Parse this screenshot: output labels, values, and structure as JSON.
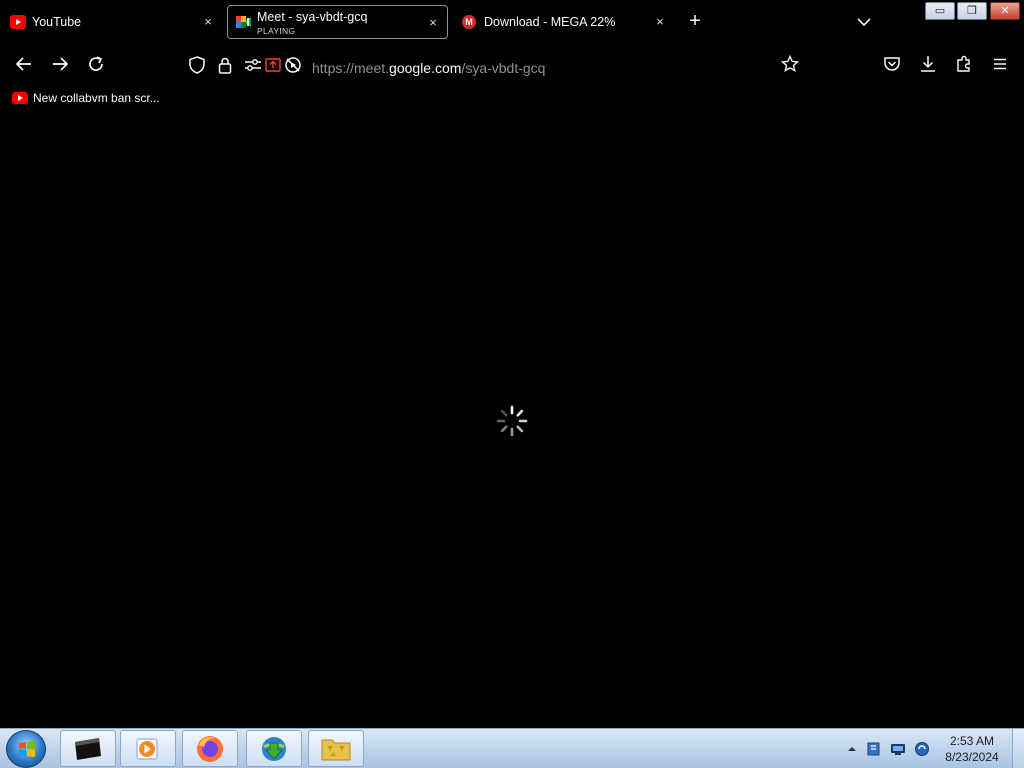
{
  "tabs": [
    {
      "label": "YouTube",
      "icon": "youtube-icon"
    },
    {
      "label": "Meet - sya-vbdt-gcq",
      "status": "PLAYING",
      "icon": "google-meet-icon"
    },
    {
      "label": "Download - MEGA 22%",
      "icon": "mega-icon",
      "icon_letter": "M"
    }
  ],
  "tab_controls": {
    "new_tab": "+",
    "close": "×"
  },
  "window_controls": {
    "minimize": "▭",
    "restore": "❐",
    "close": "✕"
  },
  "url": {
    "prefix": "https://meet.",
    "host": "google.com",
    "path": "/sya-vbdt-gcq"
  },
  "bookmarks": [
    {
      "label": "New collabvm ban scr...",
      "icon": "youtube-icon"
    }
  ],
  "taskbar": {
    "apps": [
      "cmd-icon",
      "media-player-icon",
      "firefox-icon",
      "internet-download-manager-icon",
      "folder-icon"
    ],
    "clock": {
      "time": "2:53 AM",
      "date": "8/23/2024"
    }
  },
  "colors": {
    "background": "#000000",
    "url_muted": "#8f8f9d",
    "url_host": "#fbfbfe",
    "youtube_red": "#ff0000",
    "mega_red": "#d9272e"
  }
}
